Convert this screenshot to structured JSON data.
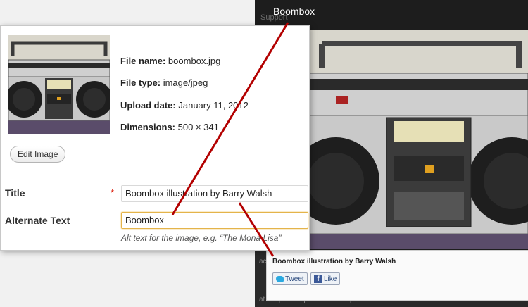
{
  "background_page": {
    "post_title": "Boombox",
    "ghost_text": "Support",
    "caption": "Boombox illustration by Barry Walsh",
    "tweet_label": "Tweet",
    "like_label": "Like",
    "under_text_1": "ac, volutpat",
    "under_text_2": "at tempus. Aliquam erat volutpat"
  },
  "attachment": {
    "file_name_label": "File name:",
    "file_name": "boombox.jpg",
    "file_type_label": "File type:",
    "file_type": "image/jpeg",
    "upload_date_label": "Upload date:",
    "upload_date": "January 11, 2012",
    "dimensions_label": "Dimensions:",
    "dimensions": "500 × 341",
    "edit_image_label": "Edit Image"
  },
  "fields": {
    "title_label": "Title",
    "required_mark": "*",
    "title_value": "Boombox illustration by Barry Walsh",
    "alt_label": "Alternate Text",
    "alt_value": "Boombox",
    "alt_help": "Alt text for the image, e.g. “The Mona Lisa”"
  },
  "colors": {
    "annotation_line": "#b30000",
    "focus_border": "#e4b44a"
  }
}
